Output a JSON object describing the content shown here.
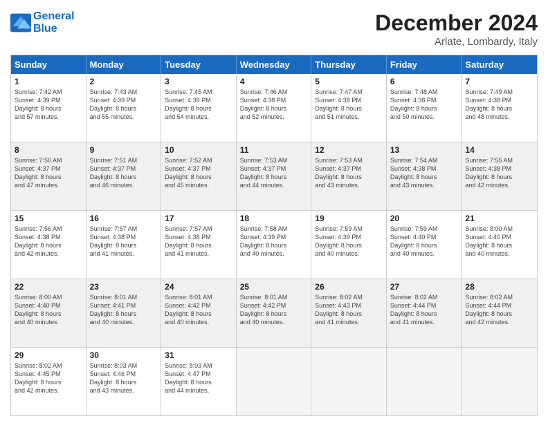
{
  "header": {
    "logo_line1": "General",
    "logo_line2": "Blue",
    "title": "December 2024",
    "location": "Arlate, Lombardy, Italy"
  },
  "days": [
    "Sunday",
    "Monday",
    "Tuesday",
    "Wednesday",
    "Thursday",
    "Friday",
    "Saturday"
  ],
  "rows": [
    [
      {
        "day": "1",
        "lines": [
          "Sunrise: 7:42 AM",
          "Sunset: 4:39 PM",
          "Daylight: 8 hours",
          "and 57 minutes."
        ]
      },
      {
        "day": "2",
        "lines": [
          "Sunrise: 7:43 AM",
          "Sunset: 4:39 PM",
          "Daylight: 8 hours",
          "and 55 minutes."
        ]
      },
      {
        "day": "3",
        "lines": [
          "Sunrise: 7:45 AM",
          "Sunset: 4:39 PM",
          "Daylight: 8 hours",
          "and 54 minutes."
        ]
      },
      {
        "day": "4",
        "lines": [
          "Sunrise: 7:46 AM",
          "Sunset: 4:38 PM",
          "Daylight: 8 hours",
          "and 52 minutes."
        ]
      },
      {
        "day": "5",
        "lines": [
          "Sunrise: 7:47 AM",
          "Sunset: 4:38 PM",
          "Daylight: 8 hours",
          "and 51 minutes."
        ]
      },
      {
        "day": "6",
        "lines": [
          "Sunrise: 7:48 AM",
          "Sunset: 4:38 PM",
          "Daylight: 8 hours",
          "and 50 minutes."
        ]
      },
      {
        "day": "7",
        "lines": [
          "Sunrise: 7:49 AM",
          "Sunset: 4:38 PM",
          "Daylight: 8 hours",
          "and 48 minutes."
        ]
      }
    ],
    [
      {
        "day": "8",
        "lines": [
          "Sunrise: 7:50 AM",
          "Sunset: 4:37 PM",
          "Daylight: 8 hours",
          "and 47 minutes."
        ]
      },
      {
        "day": "9",
        "lines": [
          "Sunrise: 7:51 AM",
          "Sunset: 4:37 PM",
          "Daylight: 8 hours",
          "and 46 minutes."
        ]
      },
      {
        "day": "10",
        "lines": [
          "Sunrise: 7:52 AM",
          "Sunset: 4:37 PM",
          "Daylight: 8 hours",
          "and 45 minutes."
        ]
      },
      {
        "day": "11",
        "lines": [
          "Sunrise: 7:53 AM",
          "Sunset: 4:37 PM",
          "Daylight: 8 hours",
          "and 44 minutes."
        ]
      },
      {
        "day": "12",
        "lines": [
          "Sunrise: 7:53 AM",
          "Sunset: 4:37 PM",
          "Daylight: 8 hours",
          "and 43 minutes."
        ]
      },
      {
        "day": "13",
        "lines": [
          "Sunrise: 7:54 AM",
          "Sunset: 4:38 PM",
          "Daylight: 8 hours",
          "and 43 minutes."
        ]
      },
      {
        "day": "14",
        "lines": [
          "Sunrise: 7:55 AM",
          "Sunset: 4:38 PM",
          "Daylight: 8 hours",
          "and 42 minutes."
        ]
      }
    ],
    [
      {
        "day": "15",
        "lines": [
          "Sunrise: 7:56 AM",
          "Sunset: 4:38 PM",
          "Daylight: 8 hours",
          "and 42 minutes."
        ]
      },
      {
        "day": "16",
        "lines": [
          "Sunrise: 7:57 AM",
          "Sunset: 4:38 PM",
          "Daylight: 8 hours",
          "and 41 minutes."
        ]
      },
      {
        "day": "17",
        "lines": [
          "Sunrise: 7:57 AM",
          "Sunset: 4:38 PM",
          "Daylight: 8 hours",
          "and 41 minutes."
        ]
      },
      {
        "day": "18",
        "lines": [
          "Sunrise: 7:58 AM",
          "Sunset: 4:39 PM",
          "Daylight: 8 hours",
          "and 40 minutes."
        ]
      },
      {
        "day": "19",
        "lines": [
          "Sunrise: 7:59 AM",
          "Sunset: 4:39 PM",
          "Daylight: 8 hours",
          "and 40 minutes."
        ]
      },
      {
        "day": "20",
        "lines": [
          "Sunrise: 7:59 AM",
          "Sunset: 4:40 PM",
          "Daylight: 8 hours",
          "and 40 minutes."
        ]
      },
      {
        "day": "21",
        "lines": [
          "Sunrise: 8:00 AM",
          "Sunset: 4:40 PM",
          "Daylight: 8 hours",
          "and 40 minutes."
        ]
      }
    ],
    [
      {
        "day": "22",
        "lines": [
          "Sunrise: 8:00 AM",
          "Sunset: 4:40 PM",
          "Daylight: 8 hours",
          "and 40 minutes."
        ]
      },
      {
        "day": "23",
        "lines": [
          "Sunrise: 8:01 AM",
          "Sunset: 4:41 PM",
          "Daylight: 8 hours",
          "and 40 minutes."
        ]
      },
      {
        "day": "24",
        "lines": [
          "Sunrise: 8:01 AM",
          "Sunset: 4:42 PM",
          "Daylight: 8 hours",
          "and 40 minutes."
        ]
      },
      {
        "day": "25",
        "lines": [
          "Sunrise: 8:01 AM",
          "Sunset: 4:42 PM",
          "Daylight: 8 hours",
          "and 40 minutes."
        ]
      },
      {
        "day": "26",
        "lines": [
          "Sunrise: 8:02 AM",
          "Sunset: 4:43 PM",
          "Daylight: 8 hours",
          "and 41 minutes."
        ]
      },
      {
        "day": "27",
        "lines": [
          "Sunrise: 8:02 AM",
          "Sunset: 4:44 PM",
          "Daylight: 8 hours",
          "and 41 minutes."
        ]
      },
      {
        "day": "28",
        "lines": [
          "Sunrise: 8:02 AM",
          "Sunset: 4:44 PM",
          "Daylight: 8 hours",
          "and 42 minutes."
        ]
      }
    ],
    [
      {
        "day": "29",
        "lines": [
          "Sunrise: 8:02 AM",
          "Sunset: 4:45 PM",
          "Daylight: 8 hours",
          "and 42 minutes."
        ]
      },
      {
        "day": "30",
        "lines": [
          "Sunrise: 8:03 AM",
          "Sunset: 4:46 PM",
          "Daylight: 8 hours",
          "and 43 minutes."
        ]
      },
      {
        "day": "31",
        "lines": [
          "Sunrise: 8:03 AM",
          "Sunset: 4:47 PM",
          "Daylight: 8 hours",
          "and 44 minutes."
        ]
      },
      null,
      null,
      null,
      null
    ]
  ]
}
